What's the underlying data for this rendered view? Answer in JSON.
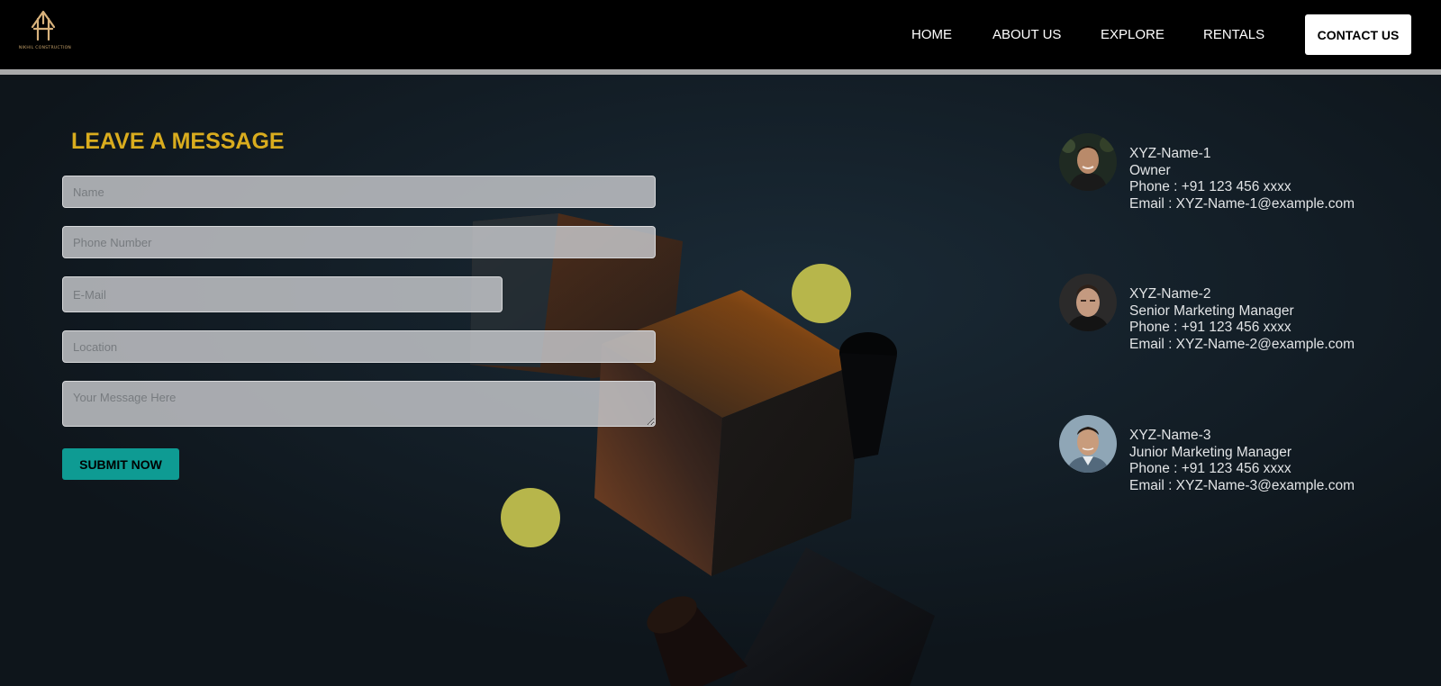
{
  "brand": {
    "logo_text": "NIKHIL CONSTRUCTION"
  },
  "nav": {
    "home": "HOME",
    "about": "ABOUT US",
    "explore": "EXPLORE",
    "rentals": "RENTALS",
    "contact": "CONTACT US"
  },
  "form": {
    "title": "LEAVE A MESSAGE",
    "name_placeholder": "Name",
    "phone_placeholder": "Phone Number",
    "email_placeholder": "E-Mail",
    "location_placeholder": "Location",
    "message_placeholder": "Your Message Here",
    "submit_label": "SUBMIT NOW"
  },
  "contacts": [
    {
      "name": "XYZ-Name-1",
      "role": "Owner",
      "phone": "Phone : +91 123 456 xxxx",
      "email": "Email : XYZ-Name-1@example.com"
    },
    {
      "name": "XYZ-Name-2",
      "role": "Senior Marketing Manager",
      "phone": "Phone : +91 123 456 xxxx",
      "email": "Email : XYZ-Name-2@example.com"
    },
    {
      "name": "XYZ-Name-3",
      "role": "Junior Marketing Manager",
      "phone": "Phone : +91 123 456 xxxx",
      "email": "Email : XYZ-Name-3@example.com"
    }
  ],
  "colors": {
    "background": "#0f161c",
    "navbar": "#000000",
    "title": "#d9ac1e",
    "submit": "#0e9b93",
    "accent_circles": "#b7b64b"
  }
}
